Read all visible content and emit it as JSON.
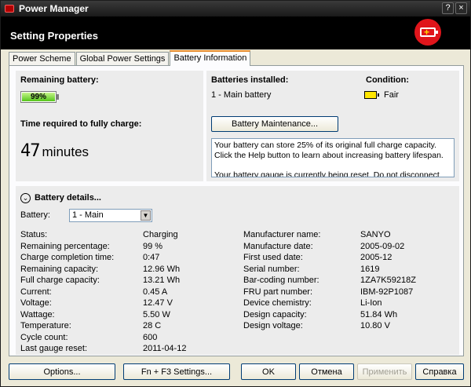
{
  "window": {
    "title": "Power Manager",
    "help_glyph": "?",
    "close_glyph": "×"
  },
  "header": {
    "title": "Setting Properties"
  },
  "tabs": [
    {
      "label": "Power Scheme"
    },
    {
      "label": "Global Power Settings"
    },
    {
      "label": "Battery Information",
      "active": true
    }
  ],
  "remaining": {
    "label": "Remaining battery:",
    "percent_text": "99%",
    "percent": 99
  },
  "charge_time": {
    "label": "Time required to fully charge:",
    "value": "47",
    "unit": "minutes"
  },
  "installed": {
    "label": "Batteries installed:",
    "value": "1 - Main battery",
    "maintenance_button": "Battery Maintenance..."
  },
  "condition": {
    "label": "Condition:",
    "value": "Fair"
  },
  "message": {
    "line1": "Your battery can store 25% of its original full charge capacity. Click the Help button to learn about increasing battery lifespan.",
    "line2": "Your battery gauge is currently being reset. Do not disconnect the ac"
  },
  "details": {
    "title": "Battery details...",
    "battery_label": "Battery:",
    "battery_selected": "1 - Main",
    "left": [
      {
        "k": "Status:",
        "v": "Charging"
      },
      {
        "k": "Remaining percentage:",
        "v": "99 %"
      },
      {
        "k": "Charge completion time:",
        "v": "0:47"
      },
      {
        "k": "Remaining capacity:",
        "v": "12.96 Wh"
      },
      {
        "k": "Full charge capacity:",
        "v": "13.21 Wh"
      },
      {
        "k": "Current:",
        "v": "0.45 A"
      },
      {
        "k": "Voltage:",
        "v": "12.47 V"
      },
      {
        "k": "Wattage:",
        "v": "5.50 W"
      },
      {
        "k": "Temperature:",
        "v": "28 C"
      },
      {
        "k": "Cycle count:",
        "v": "600"
      },
      {
        "k": "Last gauge reset:",
        "v": "2011-04-12"
      }
    ],
    "right": [
      {
        "k": "Manufacturer name:",
        "v": "SANYO"
      },
      {
        "k": "Manufacture date:",
        "v": "2005-09-02"
      },
      {
        "k": "First used date:",
        "v": "2005-12"
      },
      {
        "k": "Serial number:",
        "v": "1619"
      },
      {
        "k": "Bar-coding number:",
        "v": "1ZA7K59218Z"
      },
      {
        "k": "FRU part number:",
        "v": "IBM-92P1087"
      },
      {
        "k": "Device chemistry:",
        "v": "Li-Ion"
      },
      {
        "k": "Design capacity:",
        "v": "51.84 Wh"
      },
      {
        "k": "Design voltage:",
        "v": "10.80 V"
      }
    ]
  },
  "buttons": {
    "options": "Options...",
    "fn_f3": "Fn + F3 Settings...",
    "ok": "OK",
    "cancel": "Отмена",
    "apply": "Применить",
    "help": "Справка"
  }
}
